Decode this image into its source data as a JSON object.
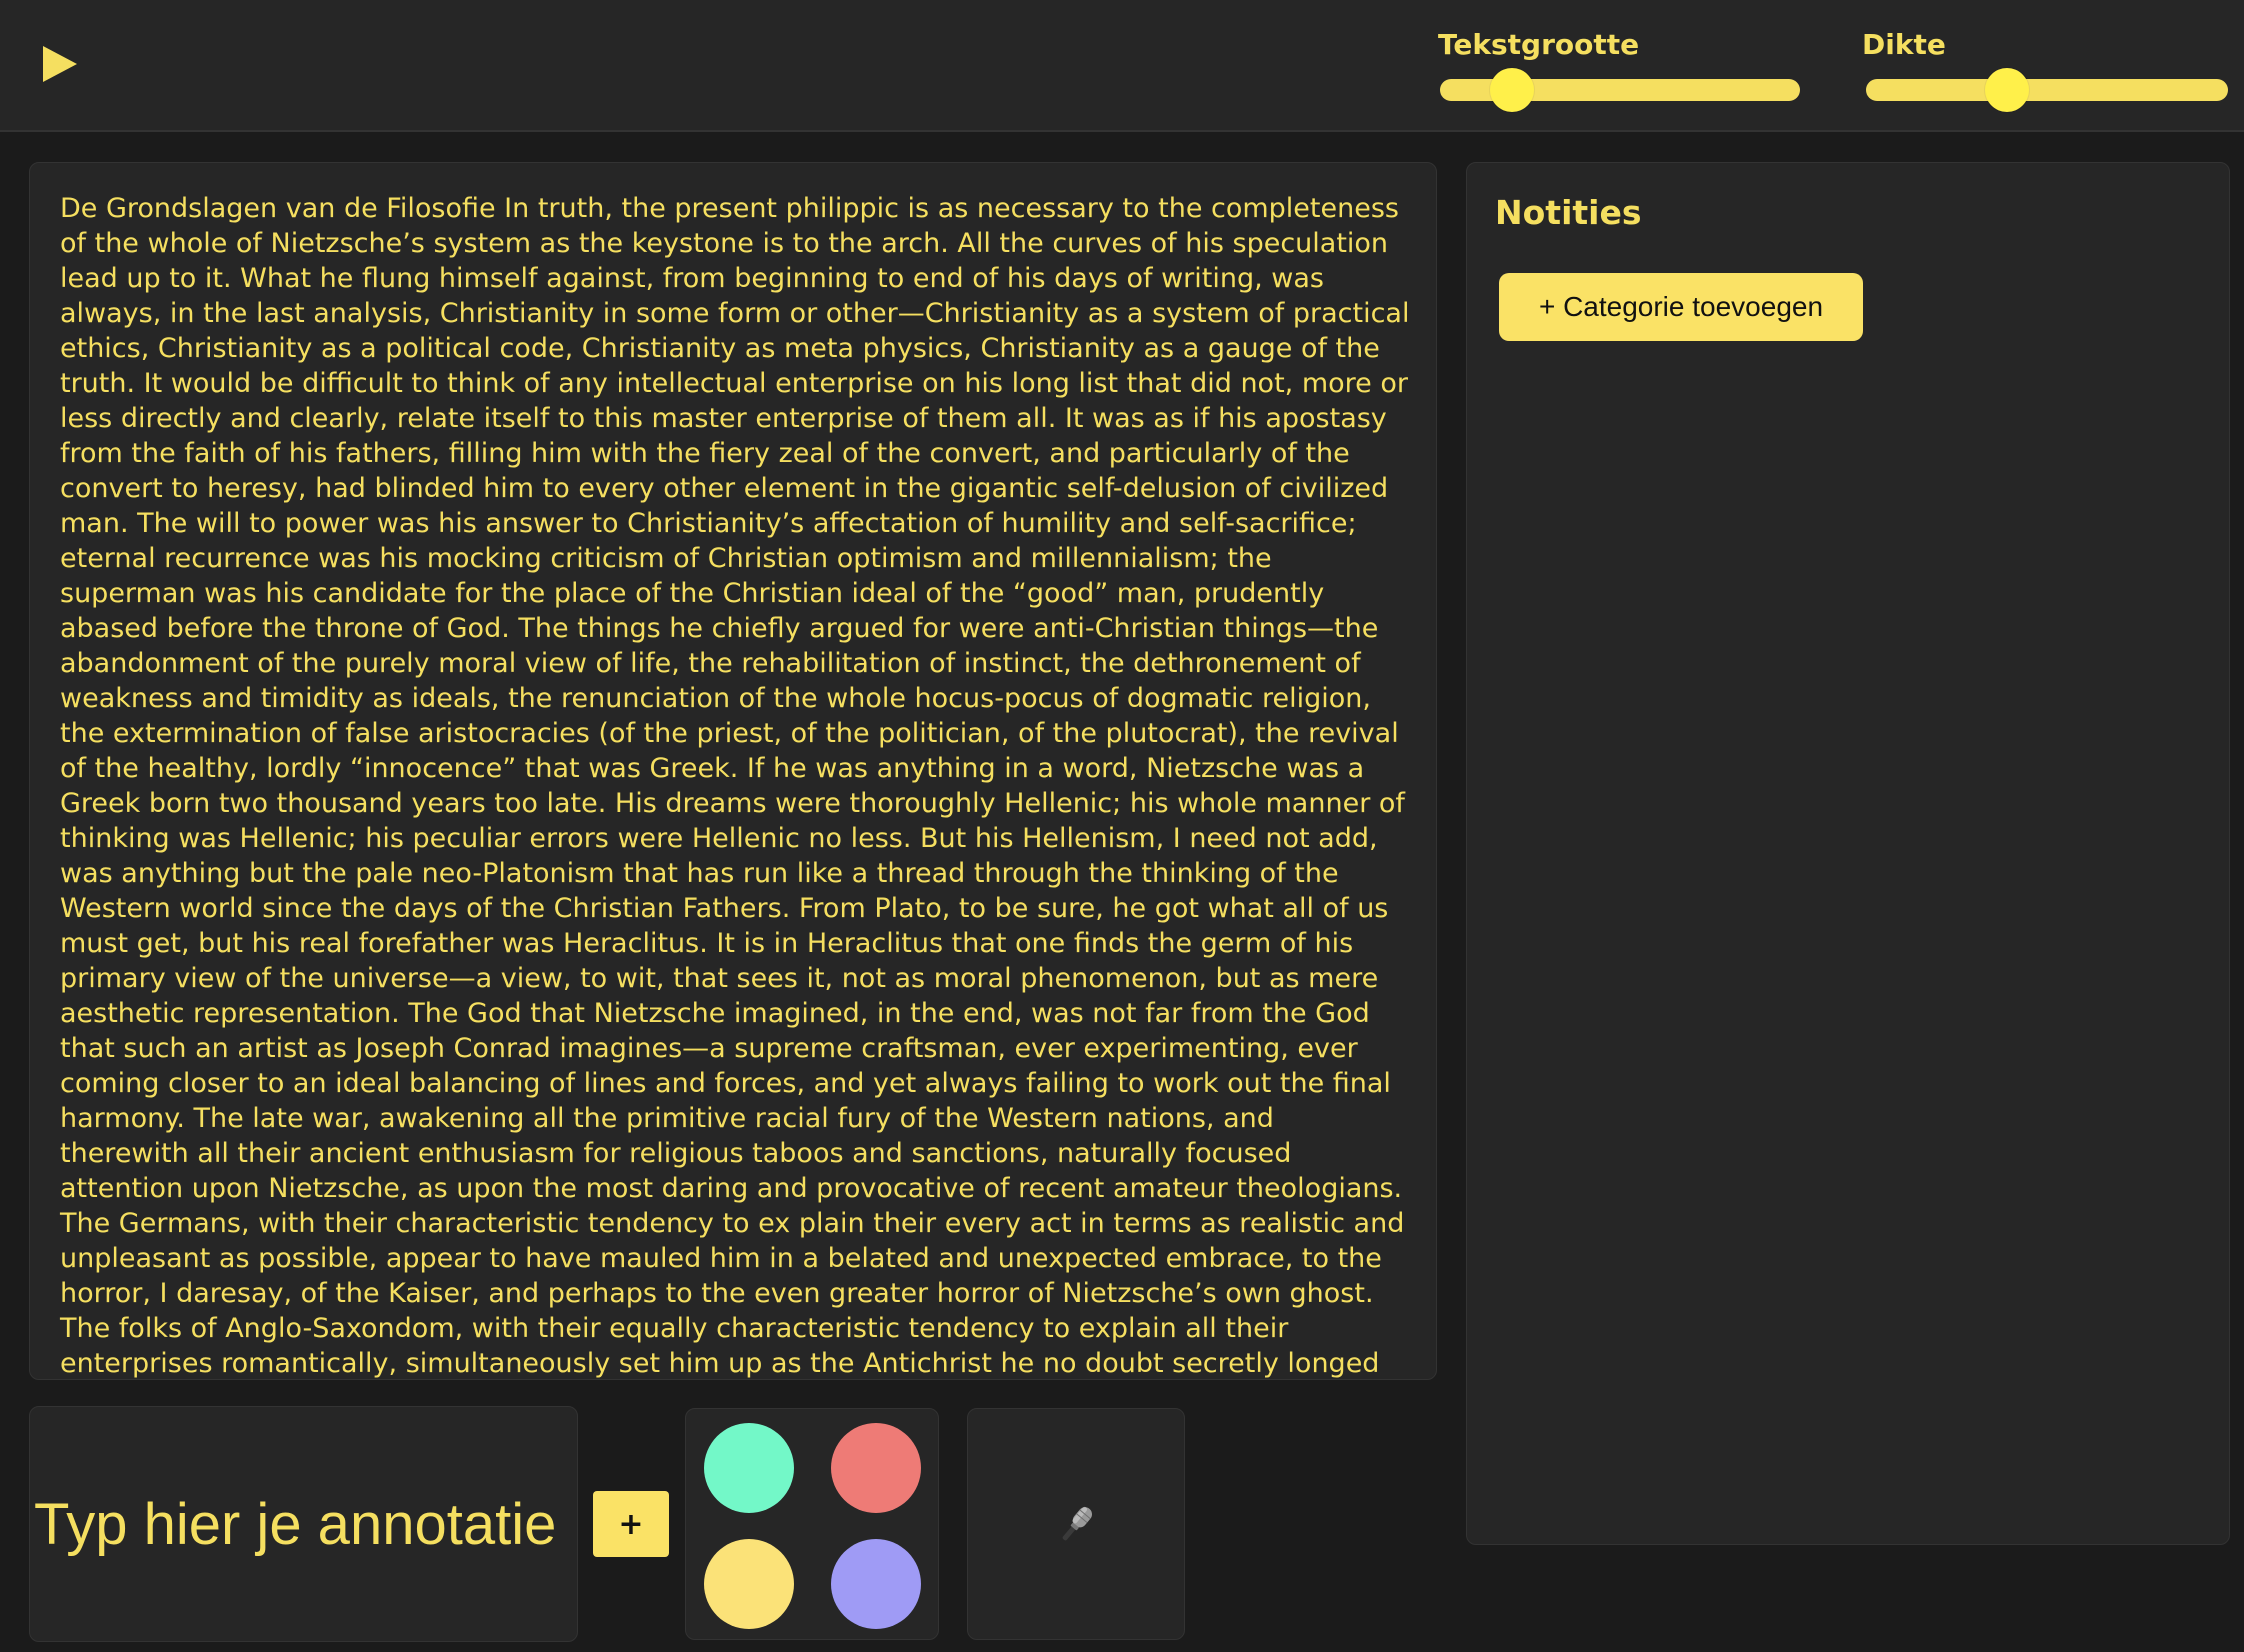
{
  "toolbar": {
    "play_icon": "play-icon",
    "text_size": {
      "label": "Tekstgrootte",
      "value": 0.2
    },
    "weight": {
      "label": "Dikte",
      "value": 0.39
    }
  },
  "reader": {
    "text": "De Grondslagen van de Filosofie In truth, the present philippic is as necessary to the completeness of the whole of Nietzsche’s system as the keystone is to the arch. All the curves of his speculation lead up to it. What he flung himself against, from beginning to end of his days of writing, was always, in the last analysis, Christianity in some form or other—Christianity as a system of practical ethics, Christianity as a political code, Christianity as meta physics, Christianity as a gauge of the truth. It would be difficult to think of any intellectual enterprise on his long list that did not, more or less directly and clearly, relate itself to this master enterprise of them all. It was as if his apostasy from the faith of his fathers, filling him with the fiery zeal of the convert, and particularly of the convert to heresy, had blinded him to every other element in the gigantic self-delusion of civilized man. The will to power was his answer to Christianity’s affectation of humility and self-sacrifice; eternal recurrence was his mocking criticism of Christian optimism and millennialism; the superman was his candidate for the place of the Christian ideal of the “good” man, prudently abased before the throne of God. The things he chiefly argued for were anti-Christian things—the abandonment of the purely moral view of life, the rehabilitation of instinct, the dethronement of weakness and timidity as ideals, the renunciation of the whole hocus-pocus of dogmatic religion, the extermination of false aristocracies (of the priest, of the politician, of the plutocrat), the revival of the healthy, lordly “innocence” that was Greek. If he was anything in a word, Nietzsche was a Greek born two thousand  years too late. His dreams were thoroughly Hellenic; his whole manner of thinking was Hellenic; his peculiar errors were Hellenic no less. But his Hellenism, I need not add, was anything but the pale neo-Platonism that has run like a thread through the thinking of the Western world since the days of the Christian Fathers. From Plato, to be sure, he got what all of us must get, but his real forefather was Heraclitus. It is in Heraclitus that one finds the germ of his primary view of the universe—a view, to wit, that sees it, not as moral phenomenon, but as mere aesthetic representation. The God that Nietzsche imagined, in the end, was not far from the God that such an artist as Joseph Conrad imagines—a supreme craftsman, ever experimenting, ever coming closer to an ideal balancing of lines and forces, and yet always failing to work out the final harmony. The late war, awakening all the primitive racial fury of the Western nations, and therewith all their ancient enthusiasm for religious taboos and sanctions, naturally focused attention upon Nietzsche, as upon the most daring and provocative of recent amateur theologians. The Germans, with their characteristic tendency to ex plain their every act in terms as realistic and unpleasant as possible, appear to have mauled him in a belated and unexpected embrace, to the horror, I daresay, of the Kaiser, and perhaps to the even greater horror of Nietzsche’s own ghost. The folks of Anglo-Saxondom, with their equally characteristic tendency to explain all their enterprises romantically, simultaneously set him up as the Antichrist he no doubt secretly longed to be. The"
  },
  "notes": {
    "title": "Notities",
    "add_category_label": "+ Categorie toevoegen"
  },
  "annotation": {
    "placeholder": "Typ hier je annotatie",
    "value": "",
    "add_label": "+"
  },
  "colors": {
    "swatches": [
      "#73f8c8",
      "#ee7b76",
      "#fbe278",
      "#9f9bf5"
    ],
    "accent": "#f5df60",
    "button": "#fae266"
  },
  "mic": {
    "icon": "microphone-icon"
  }
}
